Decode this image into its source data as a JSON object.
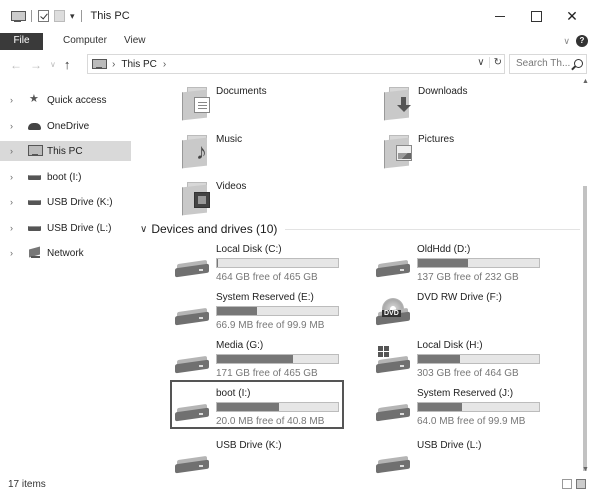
{
  "window": {
    "title": "This PC",
    "close_glyph": "✕"
  },
  "ribbon": {
    "tabs": [
      "File",
      "Computer",
      "View"
    ],
    "collapse_glyph": "∨"
  },
  "address": {
    "path": [
      "This PC"
    ],
    "separator": "›",
    "dropdown_glyph": "∨",
    "refresh_glyph": "↻"
  },
  "search": {
    "placeholder": "Search Th..."
  },
  "nav": {
    "back_glyph": "←",
    "forward_glyph": "→",
    "history_glyph": "∨",
    "up_glyph": "↑",
    "expand_glyph": "›",
    "items": [
      {
        "label": "Quick access",
        "icon": "star-icon"
      },
      {
        "label": "OneDrive",
        "icon": "cloud-icon"
      },
      {
        "label": "This PC",
        "icon": "computer-icon",
        "selected": true
      },
      {
        "label": "boot (I:)",
        "icon": "drive-icon"
      },
      {
        "label": "USB Drive (K:)",
        "icon": "drive-icon"
      },
      {
        "label": "USB Drive (L:)",
        "icon": "drive-icon"
      },
      {
        "label": "Network",
        "icon": "network-icon"
      }
    ]
  },
  "folders": [
    {
      "label": "Documents",
      "icon": "documents-folder-icon"
    },
    {
      "label": "Downloads",
      "icon": "downloads-folder-icon"
    },
    {
      "label": "Music",
      "icon": "music-folder-icon"
    },
    {
      "label": "Pictures",
      "icon": "pictures-folder-icon"
    },
    {
      "label": "Videos",
      "icon": "videos-folder-icon"
    }
  ],
  "devices": {
    "header": "Devices and drives (10)",
    "collapse_glyph": "∨",
    "drives": [
      {
        "name": "Local Disk (C:)",
        "free": "464 GB free of 465 GB",
        "used_fraction": 0.002,
        "icon": "hdd-icon"
      },
      {
        "name": "OldHdd (D:)",
        "free": "137 GB free of 232 GB",
        "used_fraction": 0.41,
        "icon": "hdd-icon"
      },
      {
        "name": "System Reserved (E:)",
        "free": "66.9 MB free of 99.9 MB",
        "used_fraction": 0.33,
        "icon": "hdd-icon"
      },
      {
        "name": "DVD RW Drive (F:)",
        "free": "",
        "used_fraction": null,
        "icon": "dvd-drive-icon"
      },
      {
        "name": "Media (G:)",
        "free": "171 GB free of 465 GB",
        "used_fraction": 0.63,
        "icon": "hdd-icon"
      },
      {
        "name": "Local Disk (H:)",
        "free": "303 GB free of 464 GB",
        "used_fraction": 0.35,
        "icon": "windows-hdd-icon"
      },
      {
        "name": "boot (I:)",
        "free": "20.0 MB free of 40.8 MB",
        "used_fraction": 0.51,
        "icon": "hdd-icon",
        "focused": true
      },
      {
        "name": "System Reserved (J:)",
        "free": "64.0 MB free of 99.9 MB",
        "used_fraction": 0.36,
        "icon": "hdd-icon"
      },
      {
        "name": "USB Drive (K:)",
        "free": "",
        "used_fraction": null,
        "icon": "hdd-icon"
      },
      {
        "name": "USB Drive (L:)",
        "free": "",
        "used_fraction": null,
        "icon": "hdd-icon"
      }
    ]
  },
  "status": {
    "items": "17 items"
  }
}
